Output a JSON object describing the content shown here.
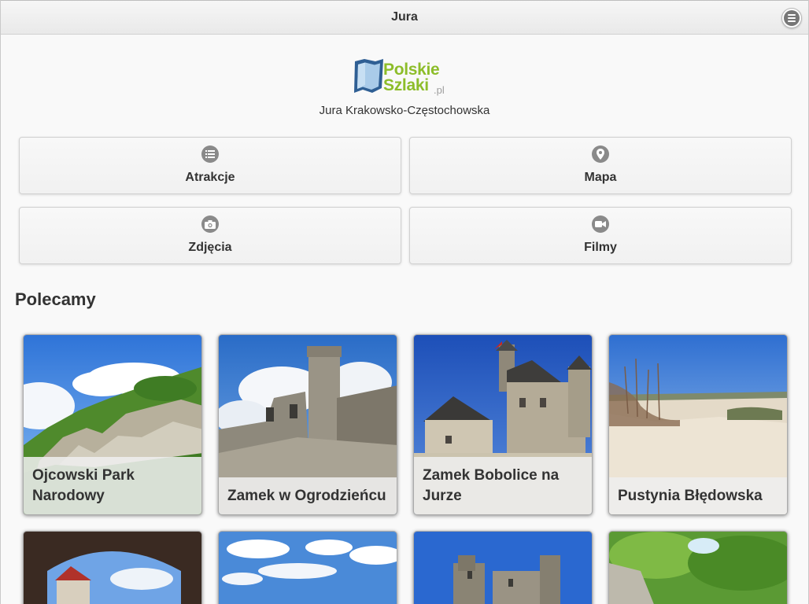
{
  "header": {
    "title": "Jura",
    "menu_icon": "menu-icon"
  },
  "logo": {
    "word1": "Polskie",
    "word2": "Szlaki",
    "suffix": ".pl"
  },
  "subtitle": "Jura Krakowsko-Częstochowska",
  "nav": [
    {
      "label": "Atrakcje",
      "icon": "list-icon"
    },
    {
      "label": "Mapa",
      "icon": "location-pin-icon"
    },
    {
      "label": "Zdjęcia",
      "icon": "camera-icon"
    },
    {
      "label": "Filmy",
      "icon": "video-icon"
    }
  ],
  "section": {
    "title": "Polecamy"
  },
  "cards": [
    {
      "title": "Ojcowski Park Narodowy"
    },
    {
      "title": "Zamek w Ogrodzieńcu"
    },
    {
      "title": "Zamek Bobolice na Jurze"
    },
    {
      "title": "Pustynia Błędowska"
    }
  ],
  "colors": {
    "brand_green": "#8dbd2a",
    "brand_blue": "#3a6fa8",
    "icon_gray": "#8a8a8a"
  }
}
